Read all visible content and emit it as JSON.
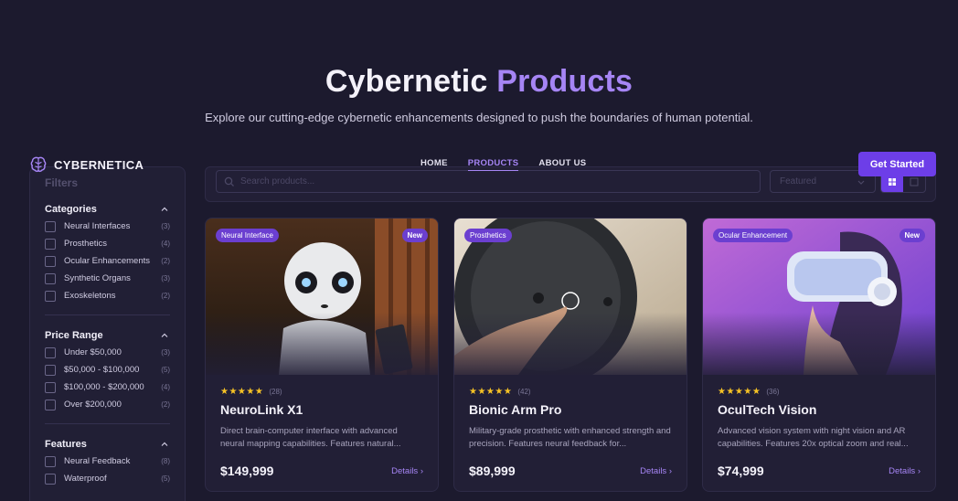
{
  "hero": {
    "title_main": "Cybernetic",
    "title_accent": "Products",
    "subtitle": "Explore our cutting-edge cybernetic enhancements designed to push the boundaries of human potential."
  },
  "navbar": {
    "brand": "CYBERNETICA",
    "links": [
      "HOME",
      "PRODUCTS",
      "ABOUT US"
    ],
    "active": "PRODUCTS",
    "cta": "Get Started"
  },
  "toolbar": {
    "search_placeholder": "Search products...",
    "sort_value": "Featured"
  },
  "sidebar": {
    "title": "Filters",
    "groups": [
      {
        "title": "Categories",
        "options": [
          {
            "label": "Neural Interfaces",
            "count": "(3)"
          },
          {
            "label": "Prosthetics",
            "count": "(4)"
          },
          {
            "label": "Ocular Enhancements",
            "count": "(2)"
          },
          {
            "label": "Synthetic Organs",
            "count": "(3)"
          },
          {
            "label": "Exoskeletons",
            "count": "(2)"
          }
        ]
      },
      {
        "title": "Price Range",
        "options": [
          {
            "label": "Under $50,000",
            "count": "(3)"
          },
          {
            "label": "$50,000 - $100,000",
            "count": "(5)"
          },
          {
            "label": "$100,000 - $200,000",
            "count": "(4)"
          },
          {
            "label": "Over $200,000",
            "count": "(2)"
          }
        ]
      },
      {
        "title": "Features",
        "options": [
          {
            "label": "Neural Feedback",
            "count": "(8)"
          },
          {
            "label": "Waterproof",
            "count": "(5)"
          }
        ]
      }
    ]
  },
  "products": [
    {
      "category": "Neural Interface",
      "badge": "New",
      "stars": "★★★★★",
      "reviews": "(28)",
      "name": "NeuroLink X1",
      "description": "Direct brain-computer interface with advanced neural mapping capabilities. Features natural...",
      "price": "$149,999",
      "details": "Details"
    },
    {
      "category": "Prosthetics",
      "badge": "",
      "stars": "★★★★★",
      "reviews": "(42)",
      "name": "Bionic Arm Pro",
      "description": "Military-grade prosthetic with enhanced strength and precision. Features neural feedback for...",
      "price": "$89,999",
      "details": "Details"
    },
    {
      "category": "Ocular Enhancement",
      "badge": "New",
      "stars": "★★★★★",
      "reviews": "(36)",
      "name": "OculTech Vision",
      "description": "Advanced vision system with night vision and AR capabilities. Features 20x optical zoom and real...",
      "price": "$74,999",
      "details": "Details"
    }
  ],
  "colors": {
    "background": "#1c1a2e",
    "accent": "#a685f5",
    "button": "#6d3ee8",
    "star": "#f7c325"
  }
}
